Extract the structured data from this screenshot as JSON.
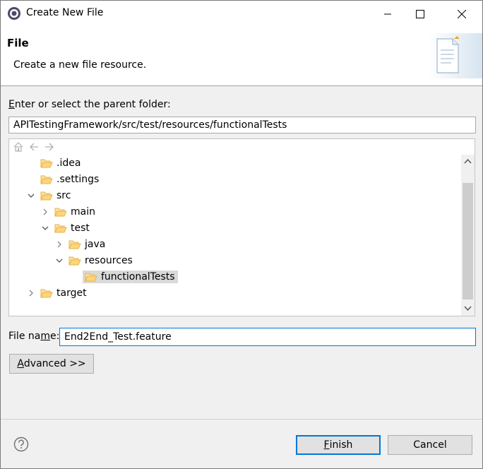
{
  "window": {
    "title": "Create New File",
    "minimize_icon": "minimize-icon",
    "maximize_icon": "maximize-icon",
    "close_icon": "close-icon"
  },
  "header": {
    "title": "File",
    "description": "Create a new file resource."
  },
  "parent_folder": {
    "label_prefix": "",
    "label_mnemonic": "E",
    "label_rest": "nter or select the parent folder:",
    "value": "APITestingFramework/src/test/resources/functionalTests"
  },
  "tree": {
    "toolbar": [
      "home-icon",
      "back-arrow-icon",
      "forward-arrow-icon"
    ],
    "items": [
      {
        "label": ".idea",
        "twisty": "none"
      },
      {
        "label": ".settings",
        "twisty": "none"
      },
      {
        "label": "src",
        "twisty": "expanded"
      },
      {
        "label": "main",
        "twisty": "collapsed"
      },
      {
        "label": "test",
        "twisty": "expanded"
      },
      {
        "label": "java",
        "twisty": "collapsed"
      },
      {
        "label": "resources",
        "twisty": "expanded"
      },
      {
        "label": "functionalTests",
        "twisty": "none",
        "selected": true
      },
      {
        "label": "target",
        "twisty": "collapsed"
      }
    ]
  },
  "file_name": {
    "label_prefix": "File na",
    "label_mnemonic": "m",
    "label_rest": "e:",
    "value": "End2End_Test.feature"
  },
  "advanced_button": {
    "mnemonic": "A",
    "rest": "dvanced >>"
  },
  "footer": {
    "help_icon": "help-icon",
    "finish": {
      "mnemonic": "F",
      "rest": "inish"
    },
    "cancel": "Cancel"
  },
  "colors": {
    "accent": "#0078d7",
    "selection": "#d9d9d9",
    "folder": "#e8b24a"
  }
}
